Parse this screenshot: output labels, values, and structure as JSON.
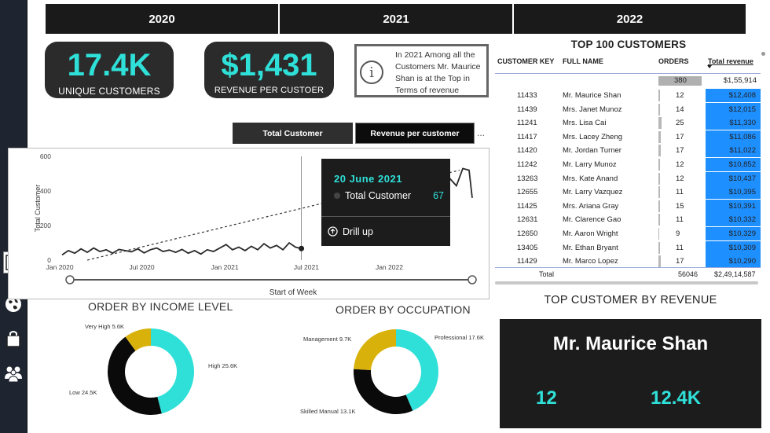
{
  "years": [
    "2020",
    "2021",
    "2022"
  ],
  "kpis": {
    "unique_customers": {
      "value": "17.4K",
      "label": "UNIQUE CUSTOMERS"
    },
    "revenue_per_customer": {
      "value": "$1,431",
      "label": "REVENUE PER CUSTOER"
    }
  },
  "insight": {
    "icon": "info-icon",
    "text": "In 2021 Among all the Customers Mr. Maurice Shan is at the Top in Terms of revenue"
  },
  "chart_toggle": {
    "total_customer": "Total Customer",
    "revenue_per_customer": "Revenue per customer",
    "more": "..."
  },
  "chart_data": {
    "type": "line",
    "ylabel": "Total Customer",
    "xlabel": "Start of Week",
    "yticks": [
      0,
      200,
      400,
      600
    ],
    "ylim": [
      0,
      600
    ],
    "xticks": [
      "Jan 2020",
      "Jul 2020",
      "Jan 2021",
      "Jul 2021",
      "Jan 2022"
    ],
    "x_range": [
      "2020-01-06",
      "2022-07-04"
    ],
    "series": [
      {
        "points": [
          [
            "2020-01-06",
            30
          ],
          [
            "2020-01-20",
            55
          ],
          [
            "2020-02-03",
            40
          ],
          [
            "2020-02-17",
            65
          ],
          [
            "2020-03-02",
            45
          ],
          [
            "2020-03-16",
            70
          ],
          [
            "2020-03-30",
            50
          ],
          [
            "2020-04-13",
            60
          ],
          [
            "2020-04-27",
            40
          ],
          [
            "2020-05-11",
            62
          ],
          [
            "2020-05-25",
            55
          ],
          [
            "2020-06-08",
            48
          ],
          [
            "2020-06-22",
            65
          ],
          [
            "2020-07-06",
            42
          ],
          [
            "2020-07-20",
            60
          ],
          [
            "2020-08-03",
            70
          ],
          [
            "2020-08-17",
            50
          ],
          [
            "2020-08-31",
            58
          ],
          [
            "2020-09-14",
            45
          ],
          [
            "2020-09-28",
            62
          ],
          [
            "2020-10-12",
            40
          ],
          [
            "2020-10-26",
            55
          ],
          [
            "2020-11-09",
            35
          ],
          [
            "2020-11-23",
            60
          ],
          [
            "2020-12-07",
            50
          ],
          [
            "2020-12-21",
            70
          ],
          [
            "2021-01-04",
            90
          ],
          [
            "2021-01-18",
            60
          ],
          [
            "2021-02-01",
            75
          ],
          [
            "2021-02-15",
            55
          ],
          [
            "2021-03-01",
            80
          ],
          [
            "2021-03-15",
            60
          ],
          [
            "2021-03-29",
            95
          ],
          [
            "2021-04-12",
            70
          ],
          [
            "2021-04-26",
            85
          ],
          [
            "2021-05-10",
            60
          ],
          [
            "2021-05-24",
            100
          ],
          [
            "2021-06-07",
            75
          ],
          [
            "2021-06-20",
            67
          ]
        ],
        "hidden_segment_end": [
          "2022-07-04",
          360
        ]
      }
    ],
    "trendline": [
      [
        "2020-03-02",
        0
      ],
      [
        "2022-06-06",
        520
      ]
    ],
    "highlight": {
      "date": "2021-06-20",
      "value": 67
    }
  },
  "tooltip": {
    "date": "20 June 2021",
    "series": "Total Customer",
    "value": "67",
    "drill_label": "Drill up"
  },
  "income": {
    "title": "ORDER BY INCOME LEVEL",
    "chart_data": {
      "type": "pie",
      "slices": [
        {
          "label": "High",
          "value_text": "25.6K",
          "value": 25600,
          "color": "#2fe0d8"
        },
        {
          "label": "Low",
          "value_text": "24.5K",
          "value": 24500,
          "color": "#0a0a0a"
        },
        {
          "label": "Very High",
          "value_text": "5.6K",
          "value": 5600,
          "color": "#d8b10a"
        }
      ]
    }
  },
  "occupation": {
    "title": "ORDER BY OCCUPATION",
    "chart_data": {
      "type": "pie",
      "slices": [
        {
          "label": "Professional",
          "value_text": "17.6K",
          "value": 17600,
          "color": "#2fe0d8"
        },
        {
          "label": "Skilled Manual",
          "value_text": "13.1K",
          "value": 13100,
          "color": "#0a0a0a"
        },
        {
          "label": "Management",
          "value_text": "9.7K",
          "value": 9700,
          "color": "#d8b10a"
        }
      ]
    }
  },
  "customers_table": {
    "title": "TOP 100 CUSTOMERS",
    "headers": {
      "key": "CUSTOMER KEY",
      "name": "FULL NAME",
      "orders": "ORDERS",
      "revenue": "Total revenue"
    },
    "partial_row": {
      "orders": "380",
      "revenue": "$1,55,914"
    },
    "rows": [
      {
        "key": "11433",
        "name": "Mr. Maurice Shan",
        "orders": "12",
        "revenue": "$12,408"
      },
      {
        "key": "11439",
        "name": "Mrs. Janet Munoz",
        "orders": "14",
        "revenue": "$12,015"
      },
      {
        "key": "11241",
        "name": "Mrs. Lisa Cai",
        "orders": "25",
        "revenue": "$11,330"
      },
      {
        "key": "11417",
        "name": "Mrs. Lacey Zheng",
        "orders": "17",
        "revenue": "$11,086"
      },
      {
        "key": "11420",
        "name": "Mr. Jordan Turner",
        "orders": "17",
        "revenue": "$11,022"
      },
      {
        "key": "11242",
        "name": "Mr. Larry Munoz",
        "orders": "12",
        "revenue": "$10,852"
      },
      {
        "key": "13263",
        "name": "Mrs. Kate Anand",
        "orders": "12",
        "revenue": "$10,437"
      },
      {
        "key": "12655",
        "name": "Mr. Larry Vazquez",
        "orders": "11",
        "revenue": "$10,395"
      },
      {
        "key": "11425",
        "name": "Mrs. Ariana Gray",
        "orders": "15",
        "revenue": "$10,391"
      },
      {
        "key": "12631",
        "name": "Mr. Clarence Gao",
        "orders": "11",
        "revenue": "$10,332"
      },
      {
        "key": "12650",
        "name": "Mr. Aaron Wright",
        "orders": "9",
        "revenue": "$10,329"
      },
      {
        "key": "13405",
        "name": "Mr. Ethan Bryant",
        "orders": "11",
        "revenue": "$10,309"
      },
      {
        "key": "11429",
        "name": "Mr. Marco Lopez",
        "orders": "17",
        "revenue": "$10,290"
      }
    ],
    "total": {
      "label": "Total",
      "orders": "56046",
      "revenue": "$2,49,14,587"
    }
  },
  "top_customer": {
    "title": "TOP CUSTOMER BY REVENUE",
    "name": "Mr. Maurice Shan",
    "orders": "12",
    "revenue": "12.4K"
  },
  "accent_color": "#2fe0d8",
  "rail_icons": [
    "report-icon",
    "globe-icon",
    "shopping-bag-icon",
    "users-icon"
  ]
}
